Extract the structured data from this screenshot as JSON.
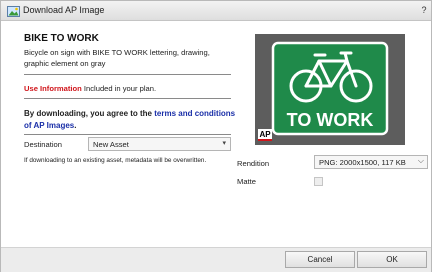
{
  "window": {
    "title": "Download AP Image",
    "help_label": "?"
  },
  "asset": {
    "title": "BIKE TO WORK",
    "description": "Bicycle on sign with BIKE TO WORK lettering, drawing, graphic element on gray"
  },
  "usage": {
    "label": "Use Information",
    "text": " Included in your plan."
  },
  "agreement": {
    "prefix": "By downloading, you agree to the ",
    "link": "terms and conditions of AP Images",
    "suffix": "."
  },
  "destination": {
    "label": "Destination",
    "value": "New Asset",
    "note": "If downloading to an existing asset, metadata will be overwritten."
  },
  "preview": {
    "sign_text": "TO WORK",
    "badge": "AP",
    "sign_color": "#1f8a4a"
  },
  "rendition": {
    "label": "Rendition",
    "value": "PNG: 2000x1500, 117 KB"
  },
  "matte": {
    "label": "Matte",
    "checked": false
  },
  "buttons": {
    "cancel": "Cancel",
    "ok": "OK"
  }
}
